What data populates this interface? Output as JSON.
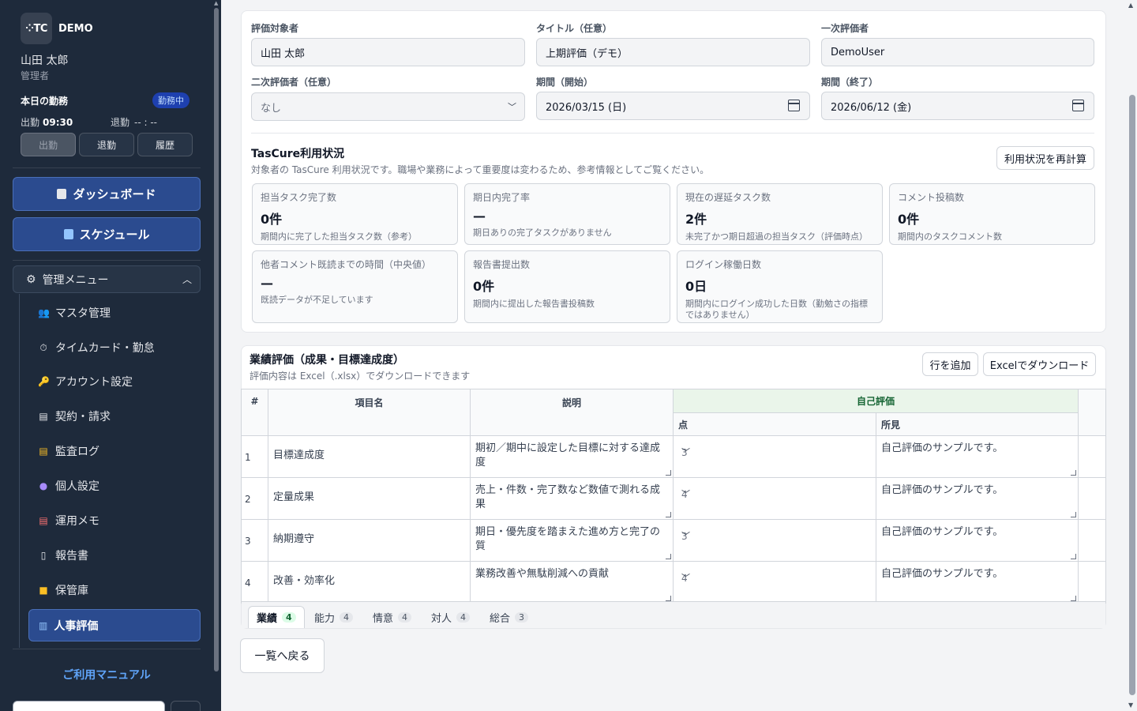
{
  "sidebar": {
    "logo_text": "⁘TC",
    "brand": "DEMO",
    "user_name": "山田 太郎",
    "user_role": "管理者",
    "attendance": {
      "title": "本日の勤務",
      "status": "勤務中",
      "in_label": "出勤",
      "in_time": "09:30",
      "out_label": "退勤",
      "out_time": "-- : --",
      "buttons": [
        "出勤",
        "退勤",
        "履歴"
      ]
    },
    "dashboard": "ダッシュボード",
    "schedule": "スケジュール",
    "admin_menu": "管理メニュー",
    "admin_items": [
      {
        "label": "マスタ管理",
        "icon": "users-icon"
      },
      {
        "label": "タイムカード・勤怠",
        "icon": "stopwatch-icon"
      },
      {
        "label": "アカウント設定",
        "icon": "key-icon"
      },
      {
        "label": "契約・請求",
        "icon": "document-icon"
      },
      {
        "label": "監査ログ",
        "icon": "scroll-icon"
      },
      {
        "label": "個人設定",
        "icon": "person-icon"
      },
      {
        "label": "運用メモ",
        "icon": "memo-icon"
      },
      {
        "label": "報告書",
        "icon": "page-icon"
      },
      {
        "label": "保管庫",
        "icon": "folder-icon"
      }
    ],
    "active_item": "人事評価",
    "manual": "ご利用マニュアル"
  },
  "form": {
    "target_label": "評価対象者",
    "target_value": "山田 太郎",
    "title_label": "タイトル（任意）",
    "title_value": "上期評価（デモ）",
    "first_label": "一次評価者",
    "first_value": "DemoUser",
    "second_label": "二次評価者（任意）",
    "second_value": "なし",
    "start_label": "期間（開始）",
    "start_value": "2026/03/15 (日)",
    "end_label": "期間（終了）",
    "end_value": "2026/06/12 (金)"
  },
  "usage": {
    "title": "TasCure利用状況",
    "desc": "対象者の TasCure 利用状況です。職場や業務によって重要度は変わるため、参考情報としてご覧ください。",
    "recalc": "利用状況を再計算",
    "stats": [
      {
        "label": "担当タスク完了数",
        "value": "0件",
        "note": "期間内に完了した担当タスク数（参考）"
      },
      {
        "label": "期日内完了率",
        "value": "—",
        "note": "期日ありの完了タスクがありません"
      },
      {
        "label": "現在の遅延タスク数",
        "value": "2件",
        "note": "未完了かつ期日超過の担当タスク（評価時点）"
      },
      {
        "label": "コメント投稿数",
        "value": "0件",
        "note": "期間内のタスクコメント数"
      },
      {
        "label": "他者コメント既読までの時間（中央値）",
        "value": "—",
        "note": "既読データが不足しています"
      },
      {
        "label": "報告書提出数",
        "value": "0件",
        "note": "期間内に提出した報告書投稿数"
      },
      {
        "label": "ログイン稼働日数",
        "value": "0日",
        "note": "期間内にログイン成功した日数（勤勉さの指標ではありません）"
      }
    ]
  },
  "performance": {
    "title": "業績評価（成果・目標達成度）",
    "sub": "評価内容は Excel（.xlsx）でダウンロードできます",
    "add_row": "行を追加",
    "download": "Excelでダウンロード",
    "headers": {
      "num": "#",
      "item": "項目名",
      "desc": "説明",
      "self": "自己評価",
      "score": "点",
      "comment": "所見"
    },
    "rows": [
      {
        "num": "1",
        "item": "目標達成度",
        "desc": "期初／期中に設定した目標に対する達成度",
        "score": "3",
        "comment": "自己評価のサンプルです。"
      },
      {
        "num": "2",
        "item": "定量成果",
        "desc": "売上・件数・完了数など数値で測れる成果",
        "score": "4",
        "comment": "自己評価のサンプルです。"
      },
      {
        "num": "3",
        "item": "納期遵守",
        "desc": "期日・優先度を踏まえた進め方と完了の質",
        "score": "3",
        "comment": "自己評価のサンプルです。"
      },
      {
        "num": "4",
        "item": "改善・効率化",
        "desc": "業務改善や無駄削減への貢献",
        "score": "4",
        "comment": "自己評価のサンプルです。"
      }
    ],
    "tabs": [
      {
        "label": "業績",
        "count": "4"
      },
      {
        "label": "能力",
        "count": "4"
      },
      {
        "label": "情意",
        "count": "4"
      },
      {
        "label": "対人",
        "count": "4"
      },
      {
        "label": "総合",
        "count": "3"
      }
    ]
  },
  "back": "一覧へ戻る"
}
